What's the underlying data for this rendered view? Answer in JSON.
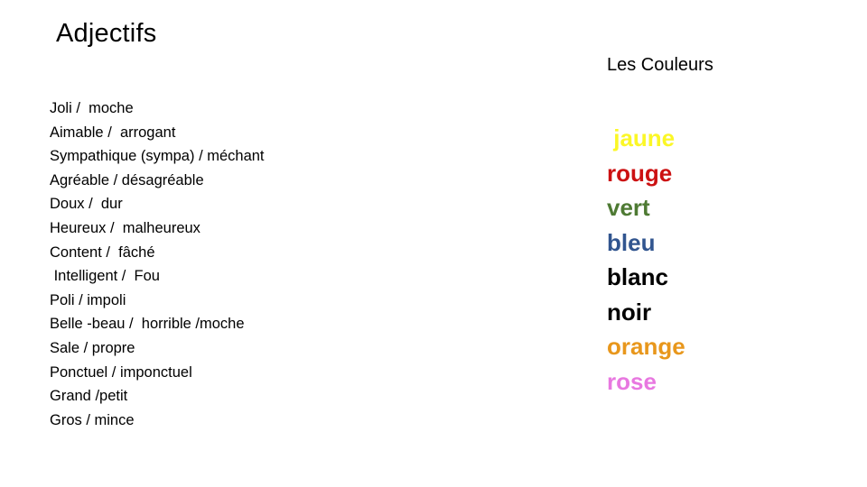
{
  "slide": {
    "title": "Adjectifs",
    "background_color": "#ffffff"
  },
  "adjectives": {
    "items": [
      "Joli /  moche",
      "Aimable /  arrogant",
      "Sympathique (sympa) / méchant",
      "Agréable / désagréable",
      "Doux /  dur",
      "Heureux /  malheureux",
      "Content /  fâché",
      " Intelligent /  Fou",
      "Poli / impoli",
      "Belle -beau /  horrible /moche",
      "Sale / propre",
      "Ponctuel / imponctuel",
      "Grand /petit",
      "Gros / mince"
    ]
  },
  "colours": {
    "heading": "Les Couleurs",
    "items": [
      {
        "label": " jaune",
        "color": "#fbf727"
      },
      {
        "label": "rouge",
        "color": "#cc1112"
      },
      {
        "label": "vert",
        "color": "#4e7a33"
      },
      {
        "label": "bleu",
        "color": "#31558f"
      },
      {
        "label": "blanc",
        "color": "#000000"
      },
      {
        "label": "noir",
        "color": "#000000"
      },
      {
        "label": "orange",
        "color": "#e8971c"
      },
      {
        "label": "rose",
        "color": "#e878e0"
      }
    ]
  }
}
